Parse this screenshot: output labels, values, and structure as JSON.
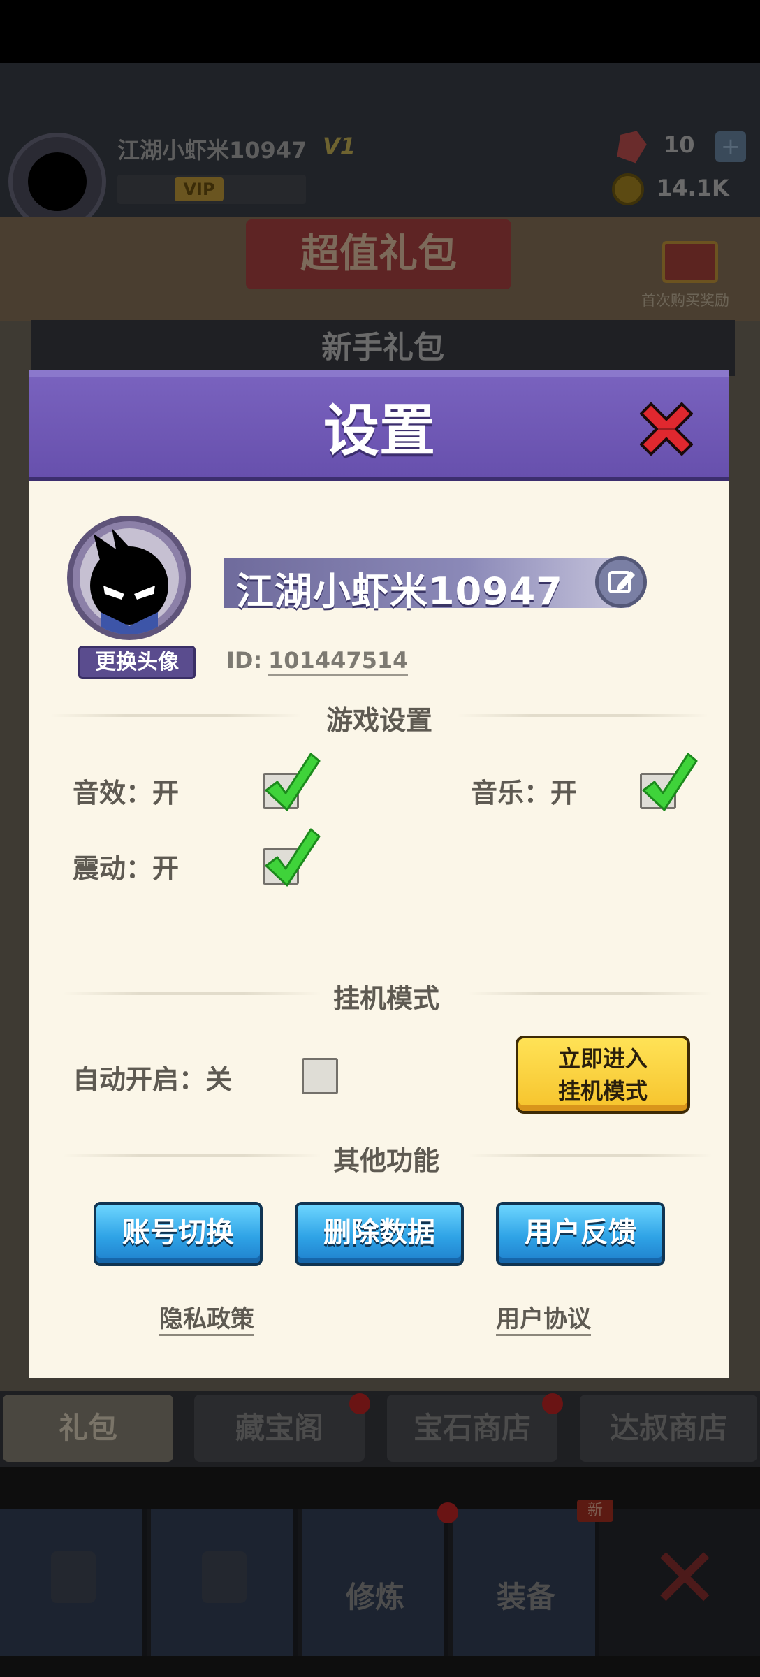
{
  "background": {
    "player_name": "江湖小虾米10947",
    "vip_level": "V1",
    "vip_badge": "VIP",
    "gems": "10",
    "add_label": "+",
    "coins": "14.1K",
    "banner": "超值礼包",
    "first_purchase": "首次购买奖励",
    "panel_title": "新手礼包",
    "tabs": [
      {
        "label": "礼包"
      },
      {
        "label": "藏宝阁"
      },
      {
        "label": "宝石商店"
      },
      {
        "label": "达叔商店"
      }
    ],
    "nav": [
      {
        "label": ""
      },
      {
        "label": ""
      },
      {
        "label": "修炼"
      },
      {
        "label": "装备"
      }
    ],
    "new_badge": "新"
  },
  "settings": {
    "title": "设置",
    "change_avatar": "更换头像",
    "player_name": "江湖小虾米10947",
    "id_label": "ID:",
    "id_value": "101447514",
    "game_settings_title": "游戏设置",
    "sound_label": "音效：开",
    "music_label": "音乐：开",
    "vibration_label": "震动：开",
    "sound_on": true,
    "music_on": true,
    "vibration_on": true,
    "idle_title": "挂机模式",
    "auto_start_label": "自动开启：关",
    "auto_start_on": false,
    "enter_idle_line1": "立即进入",
    "enter_idle_line2": "挂机模式",
    "other_title": "其他功能",
    "account_switch": "账号切换",
    "delete_data": "删除数据",
    "feedback": "用户反馈",
    "privacy": "隐私政策",
    "agreement": "用户协议"
  },
  "colors": {
    "header_purple": "#6750ad",
    "modal_bg": "#fbf6e8",
    "check_green": "#3fd33a",
    "button_blue": "#2fa3e6",
    "button_yellow": "#f6c32c"
  }
}
